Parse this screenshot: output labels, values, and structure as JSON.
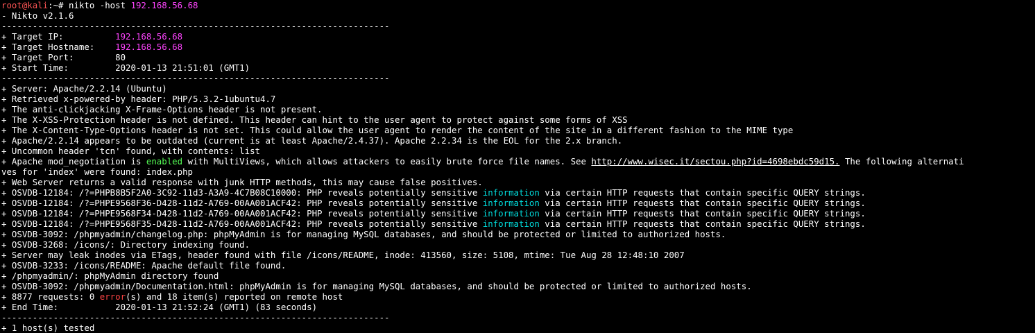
{
  "prompt": {
    "user": "root@kali",
    "path": ":~# ",
    "command": "nikto -host ",
    "target_ip": "192.168.56.68"
  },
  "lines": {
    "l1": "- Nikto v2.1.6",
    "sep1": "---------------------------------------------------------------------------",
    "target_ip_label": "+ Target IP:          ",
    "target_ip_value": "192.168.56.68",
    "target_host_label": "+ Target Hostname:    ",
    "target_host_value": "192.168.56.68",
    "target_port": "+ Target Port:        80",
    "start_time": "+ Start Time:         2020-01-13 21:51:01 (GMT1)",
    "sep2": "---------------------------------------------------------------------------",
    "server": "+ Server: Apache/2.2.14 (Ubuntu)",
    "powered": "+ Retrieved x-powered-by header: PHP/5.3.2-1ubuntu4.7",
    "clickjack": "+ The anti-clickjacking X-Frame-Options header is not present.",
    "xss": "+ The X-XSS-Protection header is not defined. This header can hint to the user agent to protect against some forms of XSS",
    "xcto": "+ The X-Content-Type-Options header is not set. This could allow the user agent to render the content of the site in a different fashion to the MIME type",
    "outdated": "+ Apache/2.2.14 appears to be outdated (current is at least Apache/2.4.37). Apache 2.2.34 is the EOL for the 2.x branch.",
    "tcn": "+ Uncommon header 'tcn' found, with contents: list",
    "mod_neg_a": "+ Apache mod_negotiation is ",
    "mod_neg_enabled": "enabled",
    "mod_neg_b": " with MultiViews, which allows attackers to easily brute force file names. See ",
    "mod_neg_link": "http://www.wisec.it/sectou.php?id=4698ebdc59d15.",
    "mod_neg_c": " The following alternati",
    "mod_neg_wrap": "ves for 'index' were found: index.php",
    "junk": "+ Web Server returns a valid response with junk HTTP methods, this may cause false positives.",
    "osvdb1_a": "+ OSVDB-12184: /?=PHPB8B5F2A0-3C92-11d3-A3A9-4C7B08C10000: PHP reveals potentially sensitive ",
    "osvdb2_a": "+ OSVDB-12184: /?=PHPE9568F36-D428-11d2-A769-00AA001ACF42: PHP reveals potentially sensitive ",
    "osvdb3_a": "+ OSVDB-12184: /?=PHPE9568F34-D428-11d2-A769-00AA001ACF42: PHP reveals potentially sensitive ",
    "osvdb4_a": "+ OSVDB-12184: /?=PHPE9568F35-D428-11d2-A769-00AA001ACF42: PHP reveals potentially sensitive ",
    "information": "information",
    "osvdb_b": " via certain HTTP requests that contain specific QUERY strings.",
    "changelog": "+ OSVDB-3092: /phpmyadmin/changelog.php: phpMyAdmin is for managing MySQL databases, and should be protected or limited to authorized hosts.",
    "icons": "+ OSVDB-3268: /icons/: Directory indexing found.",
    "inodes": "+ Server may leak inodes via ETags, header found with file /icons/README, inode: 413560, size: 5108, mtime: Tue Aug 28 12:48:10 2007",
    "readme": "+ OSVDB-3233: /icons/README: Apache default file found.",
    "pma_dir": "+ /phpmyadmin/: phpMyAdmin directory found",
    "pma_doc": "+ OSVDB-3092: /phpmyadmin/Documentation.html: phpMyAdmin is for managing MySQL databases, and should be protected or limited to authorized hosts.",
    "requests_a": "+ 8877 requests: 0 ",
    "requests_error": "error",
    "requests_b": "(s) and 18 item(s) reported on remote host",
    "end_time": "+ End Time:           2020-01-13 21:52:24 (GMT1) (83 seconds)",
    "sep3": "---------------------------------------------------------------------------",
    "hosts": "+ 1 host(s) tested"
  },
  "colors": {
    "background": "#000000",
    "foreground": "#ffffff",
    "prompt_user": "#ff5555",
    "ip": "#ff44ff",
    "enabled": "#55ff55",
    "information": "#00dddd",
    "error": "#ff4444"
  }
}
